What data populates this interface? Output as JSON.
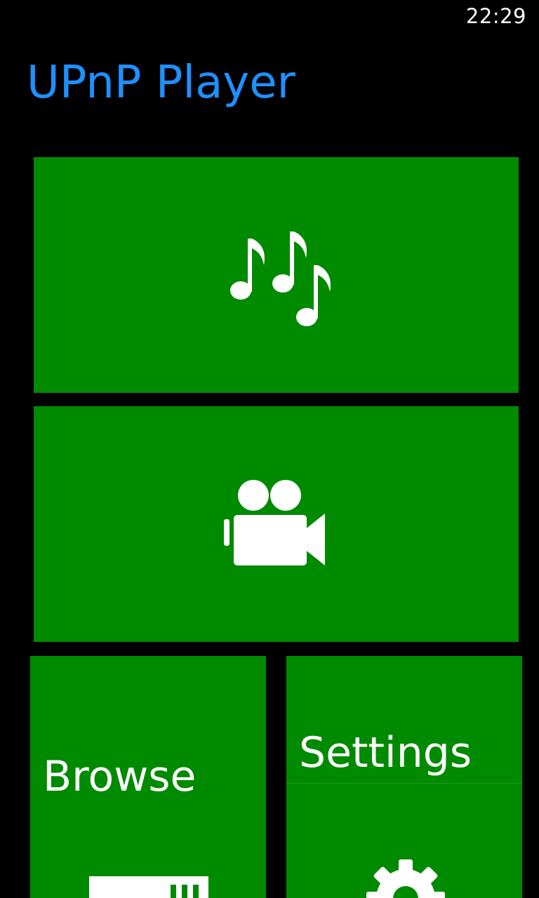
{
  "status_bar": {
    "time": "22:29"
  },
  "app": {
    "title": "UPnP Player"
  },
  "tiles": {
    "music": {
      "icon": "music-notes-icon"
    },
    "video": {
      "icon": "video-camera-icon"
    },
    "browse": {
      "label": "Browse",
      "icon": "browse-icon"
    },
    "settings": {
      "label": "Settings",
      "icon": "gear-icon"
    }
  },
  "colors": {
    "background": "#000000",
    "accent": "#1e90ff",
    "tile": "#008a00",
    "text": "#ffffff"
  }
}
